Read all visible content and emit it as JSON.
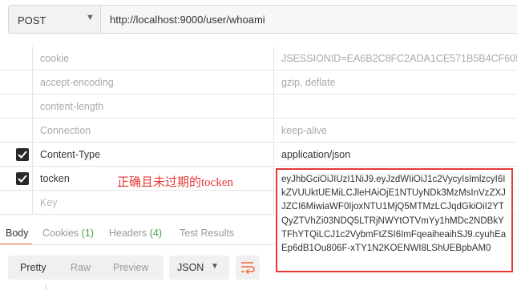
{
  "request": {
    "method": "POST",
    "url": "http://localhost:9000/user/whoami"
  },
  "headers": [
    {
      "key": "cookie",
      "value": "JSESSIONID=EA6B2C8FC2ADA1CE571B5B4CF605...",
      "enabled": false
    },
    {
      "key": "accept-encoding",
      "value": "gzip, deflate",
      "enabled": false
    },
    {
      "key": "content-length",
      "value": "",
      "enabled": false
    },
    {
      "key": "Connection",
      "value": "keep-alive",
      "enabled": false
    },
    {
      "key": "Content-Type",
      "value": "application/json",
      "enabled": true
    },
    {
      "key": "tocken",
      "value": "",
      "enabled": true
    },
    {
      "key": "Key",
      "value": "",
      "placeholder": true
    }
  ],
  "annotation": "正确且未过期的tocken",
  "token_value": "eyJhbGciOiJIUzI1NiJ9.eyJzdWIiOiJ1c2VycyIsImlzcyI6IkZVUUktUEMiLCJleHAiOjE1NTUyNDk3MzMsInVzZXJJZCI6MiwiaWF0IjoxNTU1MjQ5MTMzLCJqdGkiOiI2YTQyZTVhZi03NDQ5LTRjNWYtOTVmYy1hMDc2NDBkYTFhYTQiLCJ1c2VybmFtZSI6ImFqeaiheaihSJ9.cyuhEaEp6dB1Ou806F-xTY1N2KOENWI8LShUEBpbAM0",
  "response_tabs": {
    "body": "Body",
    "cookies": "Cookies",
    "cookies_count": "(1)",
    "headers": "Headers",
    "headers_count": "(4)",
    "test_results": "Test Results"
  },
  "toolbar": {
    "pretty": "Pretty",
    "raw": "Raw",
    "preview": "Preview",
    "format": "JSON"
  },
  "colors": {
    "accent": "#f26b3a",
    "annotation": "#e53935",
    "count": "#43a047"
  }
}
